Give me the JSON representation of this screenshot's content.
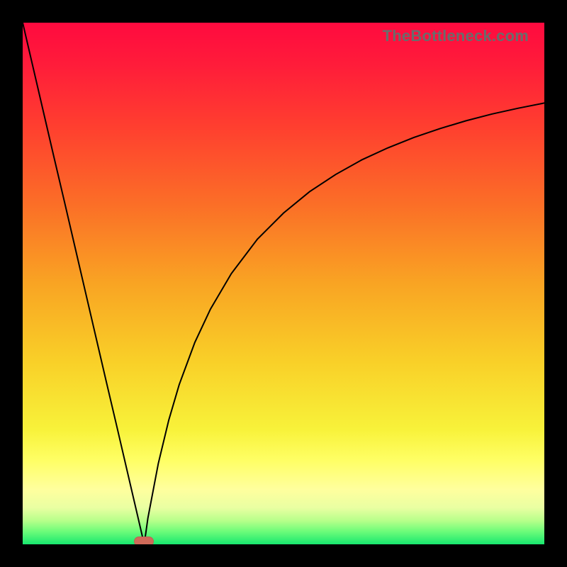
{
  "watermark": {
    "text": "TheBottleneck.com"
  },
  "colors": {
    "frame": "#000000",
    "curve": "#000000",
    "marker_fill": "#cf6a59",
    "gradient_stops": [
      {
        "offset": 0.0,
        "color": "#ff0a3f"
      },
      {
        "offset": 0.08,
        "color": "#ff1c3a"
      },
      {
        "offset": 0.2,
        "color": "#ff3f2f"
      },
      {
        "offset": 0.35,
        "color": "#fb6f27"
      },
      {
        "offset": 0.5,
        "color": "#f9a423"
      },
      {
        "offset": 0.65,
        "color": "#f9d028"
      },
      {
        "offset": 0.78,
        "color": "#f8f23a"
      },
      {
        "offset": 0.84,
        "color": "#ffff66"
      },
      {
        "offset": 0.895,
        "color": "#ffff9e"
      },
      {
        "offset": 0.93,
        "color": "#e9ffa2"
      },
      {
        "offset": 0.955,
        "color": "#b6ff8a"
      },
      {
        "offset": 0.975,
        "color": "#6efc7a"
      },
      {
        "offset": 1.0,
        "color": "#18e86f"
      }
    ]
  },
  "chart_data": {
    "type": "line",
    "title": "",
    "xlabel": "",
    "ylabel": "",
    "xlim": [
      0,
      100
    ],
    "ylim": [
      0,
      100
    ],
    "grid": false,
    "series": [
      {
        "name": "left-branch",
        "x": [
          0,
          2,
          4,
          6,
          8,
          10,
          12,
          14,
          16,
          18,
          20,
          22,
          23.3
        ],
        "values": [
          100,
          91.4,
          82.8,
          74.2,
          65.7,
          57.1,
          48.5,
          39.9,
          31.3,
          22.8,
          14.2,
          5.6,
          0
        ]
      },
      {
        "name": "right-branch",
        "x": [
          23.3,
          24,
          26,
          28,
          30,
          33,
          36,
          40,
          45,
          50,
          55,
          60,
          65,
          70,
          75,
          80,
          85,
          90,
          95,
          100
        ],
        "values": [
          0,
          5.0,
          15.5,
          23.8,
          30.6,
          38.7,
          45.1,
          51.9,
          58.5,
          63.5,
          67.6,
          70.9,
          73.7,
          76.0,
          78.0,
          79.7,
          81.2,
          82.5,
          83.6,
          84.6
        ]
      }
    ],
    "annotations": [
      {
        "name": "minimum-marker",
        "x": 23.3,
        "y": 0.5,
        "color": "#cf6a59"
      }
    ],
    "background": "rainbow vertical gradient (red→green)"
  }
}
